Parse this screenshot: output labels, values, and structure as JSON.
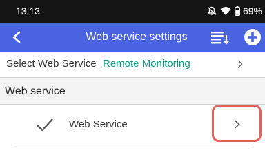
{
  "status_bar": {
    "time": "13:13",
    "battery_percent": "69%",
    "icons": [
      "silent-mode-icon",
      "wifi-icon",
      "battery-icon"
    ]
  },
  "app_bar": {
    "title": "Web service settings",
    "icons": [
      "back-arrow-icon",
      "sort-list-icon",
      "add-circle-icon"
    ]
  },
  "select_row": {
    "label": "Select Web Service",
    "value": "Remote Monitoring",
    "value_color": "#159a8b"
  },
  "section": {
    "title": "Web service"
  },
  "service_item": {
    "label": "Web Service",
    "checked": true
  },
  "colors": {
    "app_bar": "#4a63e0",
    "status_bar": "#141414",
    "highlight": "#e0645c"
  }
}
